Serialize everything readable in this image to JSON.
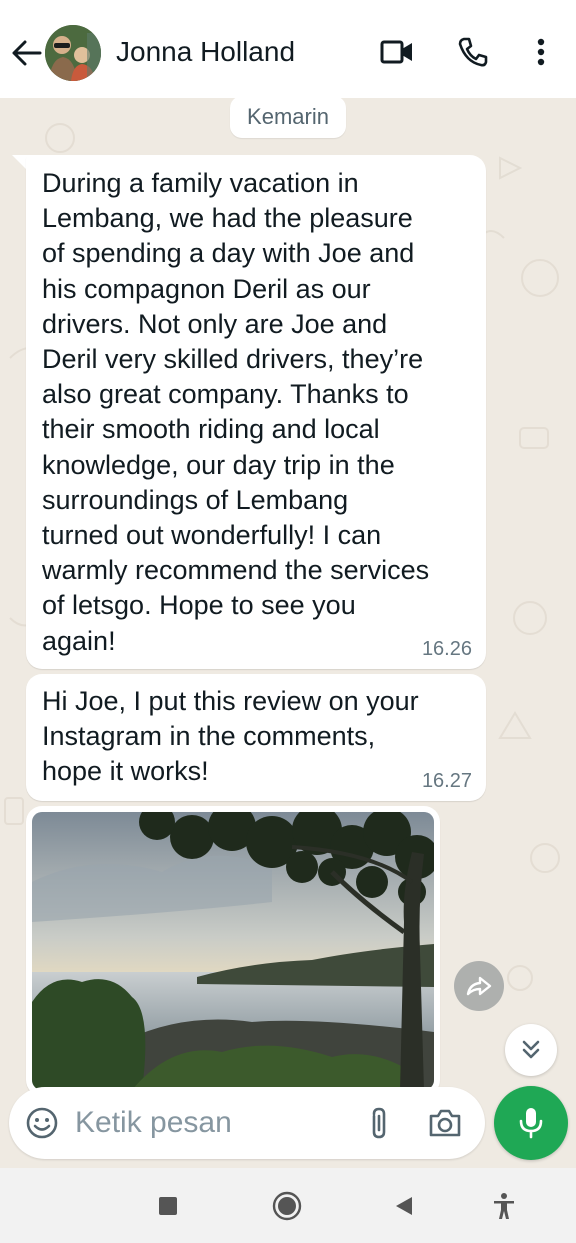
{
  "header": {
    "contact_name": "Jonna Holland",
    "icons": {
      "back": "back-arrow-icon",
      "video": "video-call-icon",
      "call": "phone-icon",
      "menu": "more-vertical-icon"
    }
  },
  "chat": {
    "date_label": "Kemarin",
    "messages": [
      {
        "text": "During a family vacation in\nLembang, we had the pleasure\nof spending a day with Joe and\nhis compagnon Deril as our\ndrivers. Not only are Joe and\nDeril very skilled drivers, they’re\nalso great company. Thanks to\ntheir smooth riding and local\nknowledge, our day trip in the\nsurroundings of Lembang\nturned out wonderfully! I can\nwarmly recommend the services\nof letsgo. Hope to see you\nagain!",
        "time": "16.26"
      },
      {
        "text": "Hi Joe, I put this review on your\nInstagram in the comments,\nhope it works!",
        "time": "16.27"
      }
    ],
    "image_message": {
      "icon": "photo-image",
      "forward_icon": "forward-icon"
    },
    "scroll_down_icon": "double-chevron-down-icon"
  },
  "composer": {
    "placeholder": "Ketik pesan",
    "value": "",
    "icons": {
      "emoji": "emoji-icon",
      "attach": "paperclip-icon",
      "camera": "camera-icon",
      "mic": "microphone-icon"
    }
  },
  "navbar": {
    "icons": [
      "recents-icon",
      "home-icon",
      "back-icon",
      "accessibility-icon"
    ]
  },
  "colors": {
    "accent": "#1fa855",
    "chat_background": "#efeae2",
    "bubble": "#ffffff",
    "timestamp": "#667781"
  }
}
